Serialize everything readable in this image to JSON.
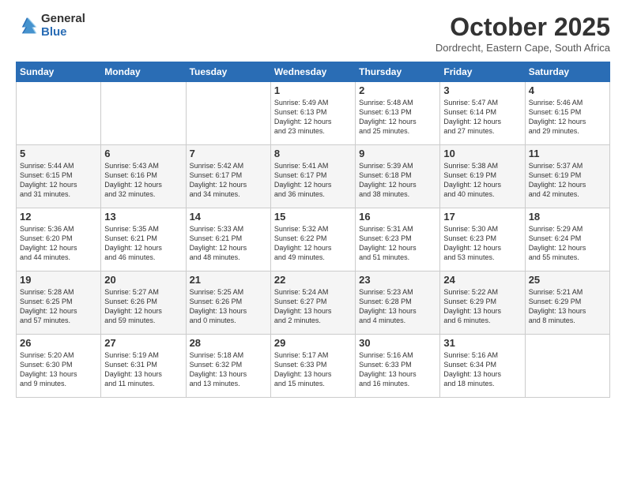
{
  "logo": {
    "general": "General",
    "blue": "Blue"
  },
  "title": "October 2025",
  "subtitle": "Dordrecht, Eastern Cape, South Africa",
  "headers": [
    "Sunday",
    "Monday",
    "Tuesday",
    "Wednesday",
    "Thursday",
    "Friday",
    "Saturday"
  ],
  "weeks": [
    [
      {
        "day": "",
        "info": ""
      },
      {
        "day": "",
        "info": ""
      },
      {
        "day": "",
        "info": ""
      },
      {
        "day": "1",
        "info": "Sunrise: 5:49 AM\nSunset: 6:13 PM\nDaylight: 12 hours\nand 23 minutes."
      },
      {
        "day": "2",
        "info": "Sunrise: 5:48 AM\nSunset: 6:13 PM\nDaylight: 12 hours\nand 25 minutes."
      },
      {
        "day": "3",
        "info": "Sunrise: 5:47 AM\nSunset: 6:14 PM\nDaylight: 12 hours\nand 27 minutes."
      },
      {
        "day": "4",
        "info": "Sunrise: 5:46 AM\nSunset: 6:15 PM\nDaylight: 12 hours\nand 29 minutes."
      }
    ],
    [
      {
        "day": "5",
        "info": "Sunrise: 5:44 AM\nSunset: 6:15 PM\nDaylight: 12 hours\nand 31 minutes."
      },
      {
        "day": "6",
        "info": "Sunrise: 5:43 AM\nSunset: 6:16 PM\nDaylight: 12 hours\nand 32 minutes."
      },
      {
        "day": "7",
        "info": "Sunrise: 5:42 AM\nSunset: 6:17 PM\nDaylight: 12 hours\nand 34 minutes."
      },
      {
        "day": "8",
        "info": "Sunrise: 5:41 AM\nSunset: 6:17 PM\nDaylight: 12 hours\nand 36 minutes."
      },
      {
        "day": "9",
        "info": "Sunrise: 5:39 AM\nSunset: 6:18 PM\nDaylight: 12 hours\nand 38 minutes."
      },
      {
        "day": "10",
        "info": "Sunrise: 5:38 AM\nSunset: 6:19 PM\nDaylight: 12 hours\nand 40 minutes."
      },
      {
        "day": "11",
        "info": "Sunrise: 5:37 AM\nSunset: 6:19 PM\nDaylight: 12 hours\nand 42 minutes."
      }
    ],
    [
      {
        "day": "12",
        "info": "Sunrise: 5:36 AM\nSunset: 6:20 PM\nDaylight: 12 hours\nand 44 minutes."
      },
      {
        "day": "13",
        "info": "Sunrise: 5:35 AM\nSunset: 6:21 PM\nDaylight: 12 hours\nand 46 minutes."
      },
      {
        "day": "14",
        "info": "Sunrise: 5:33 AM\nSunset: 6:21 PM\nDaylight: 12 hours\nand 48 minutes."
      },
      {
        "day": "15",
        "info": "Sunrise: 5:32 AM\nSunset: 6:22 PM\nDaylight: 12 hours\nand 49 minutes."
      },
      {
        "day": "16",
        "info": "Sunrise: 5:31 AM\nSunset: 6:23 PM\nDaylight: 12 hours\nand 51 minutes."
      },
      {
        "day": "17",
        "info": "Sunrise: 5:30 AM\nSunset: 6:23 PM\nDaylight: 12 hours\nand 53 minutes."
      },
      {
        "day": "18",
        "info": "Sunrise: 5:29 AM\nSunset: 6:24 PM\nDaylight: 12 hours\nand 55 minutes."
      }
    ],
    [
      {
        "day": "19",
        "info": "Sunrise: 5:28 AM\nSunset: 6:25 PM\nDaylight: 12 hours\nand 57 minutes."
      },
      {
        "day": "20",
        "info": "Sunrise: 5:27 AM\nSunset: 6:26 PM\nDaylight: 12 hours\nand 59 minutes."
      },
      {
        "day": "21",
        "info": "Sunrise: 5:25 AM\nSunset: 6:26 PM\nDaylight: 13 hours\nand 0 minutes."
      },
      {
        "day": "22",
        "info": "Sunrise: 5:24 AM\nSunset: 6:27 PM\nDaylight: 13 hours\nand 2 minutes."
      },
      {
        "day": "23",
        "info": "Sunrise: 5:23 AM\nSunset: 6:28 PM\nDaylight: 13 hours\nand 4 minutes."
      },
      {
        "day": "24",
        "info": "Sunrise: 5:22 AM\nSunset: 6:29 PM\nDaylight: 13 hours\nand 6 minutes."
      },
      {
        "day": "25",
        "info": "Sunrise: 5:21 AM\nSunset: 6:29 PM\nDaylight: 13 hours\nand 8 minutes."
      }
    ],
    [
      {
        "day": "26",
        "info": "Sunrise: 5:20 AM\nSunset: 6:30 PM\nDaylight: 13 hours\nand 9 minutes."
      },
      {
        "day": "27",
        "info": "Sunrise: 5:19 AM\nSunset: 6:31 PM\nDaylight: 13 hours\nand 11 minutes."
      },
      {
        "day": "28",
        "info": "Sunrise: 5:18 AM\nSunset: 6:32 PM\nDaylight: 13 hours\nand 13 minutes."
      },
      {
        "day": "29",
        "info": "Sunrise: 5:17 AM\nSunset: 6:33 PM\nDaylight: 13 hours\nand 15 minutes."
      },
      {
        "day": "30",
        "info": "Sunrise: 5:16 AM\nSunset: 6:33 PM\nDaylight: 13 hours\nand 16 minutes."
      },
      {
        "day": "31",
        "info": "Sunrise: 5:16 AM\nSunset: 6:34 PM\nDaylight: 13 hours\nand 18 minutes."
      },
      {
        "day": "",
        "info": ""
      }
    ]
  ]
}
